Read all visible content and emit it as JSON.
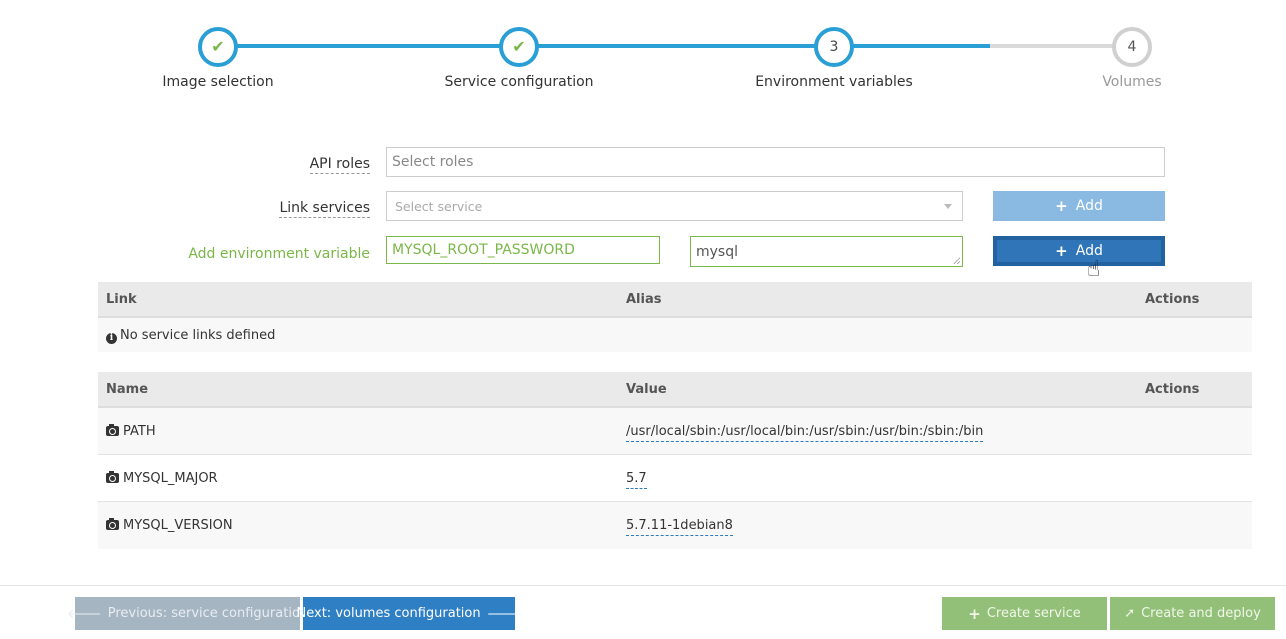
{
  "wizard": {
    "steps": [
      {
        "label": "Image selection",
        "marker": "✔",
        "state": "done"
      },
      {
        "label": "Service configuration",
        "marker": "✔",
        "state": "done"
      },
      {
        "label": "Environment variables",
        "marker": "3",
        "state": "current"
      },
      {
        "label": "Volumes",
        "marker": "4",
        "state": "pending"
      }
    ]
  },
  "form": {
    "api_roles_label": "API roles",
    "api_roles_placeholder": "Select roles",
    "link_services_label": "Link services",
    "link_services_placeholder": "Select service",
    "add_env_label": "Add environment variable",
    "env_name_value": "MYSQL_ROOT_PASSWORD",
    "env_value_value": "mysql",
    "add_button_label": "Add"
  },
  "links_table": {
    "headers": [
      "Link",
      "Alias",
      "Actions"
    ],
    "empty_message": "No service links defined"
  },
  "env_table": {
    "headers": [
      "Name",
      "Value",
      "Actions"
    ],
    "rows": [
      {
        "name": "PATH",
        "value": "/usr/local/sbin:/usr/local/bin:/usr/sbin:/usr/bin:/sbin:/bin"
      },
      {
        "name": "MYSQL_MAJOR",
        "value": "5.7"
      },
      {
        "name": "MYSQL_VERSION",
        "value": "5.7.11-1debian8"
      }
    ]
  },
  "footer": {
    "prev_label": "Previous: service configuration",
    "next_label": "Next: volumes configuration",
    "create_label": "Create service",
    "deploy_label": "Create and deploy"
  },
  "colors": {
    "accent": "#2a9fd6",
    "success": "#7ab648",
    "primary_button": "#2f75b8"
  }
}
